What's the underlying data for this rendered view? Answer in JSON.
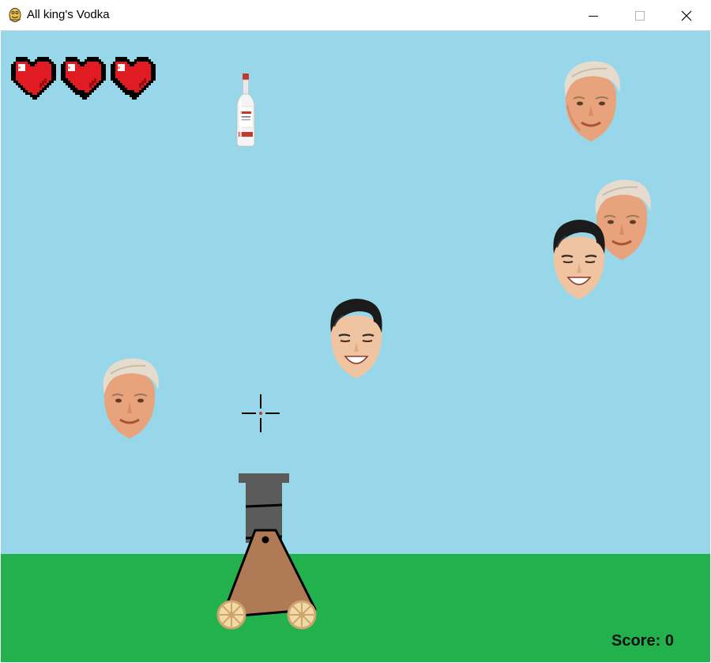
{
  "window": {
    "title": "All king's Vodka",
    "app_icon": "python-snake-icon",
    "controls": [
      "minimize-icon",
      "maximize-icon",
      "close-icon"
    ]
  },
  "game": {
    "colors": {
      "sky": "#97d7e9",
      "ground": "#22b14c",
      "heart": "#e01b22",
      "cannon_body": "#b07a56",
      "barrel": "#5b5b5b"
    },
    "lives": 3,
    "score_label": "Score:",
    "score_value": "0",
    "sprites": [
      "vodka-bottle",
      "trump-head",
      "trump-head",
      "kim-head",
      "kim-head",
      "trump-head",
      "crosshair",
      "cannon"
    ]
  }
}
